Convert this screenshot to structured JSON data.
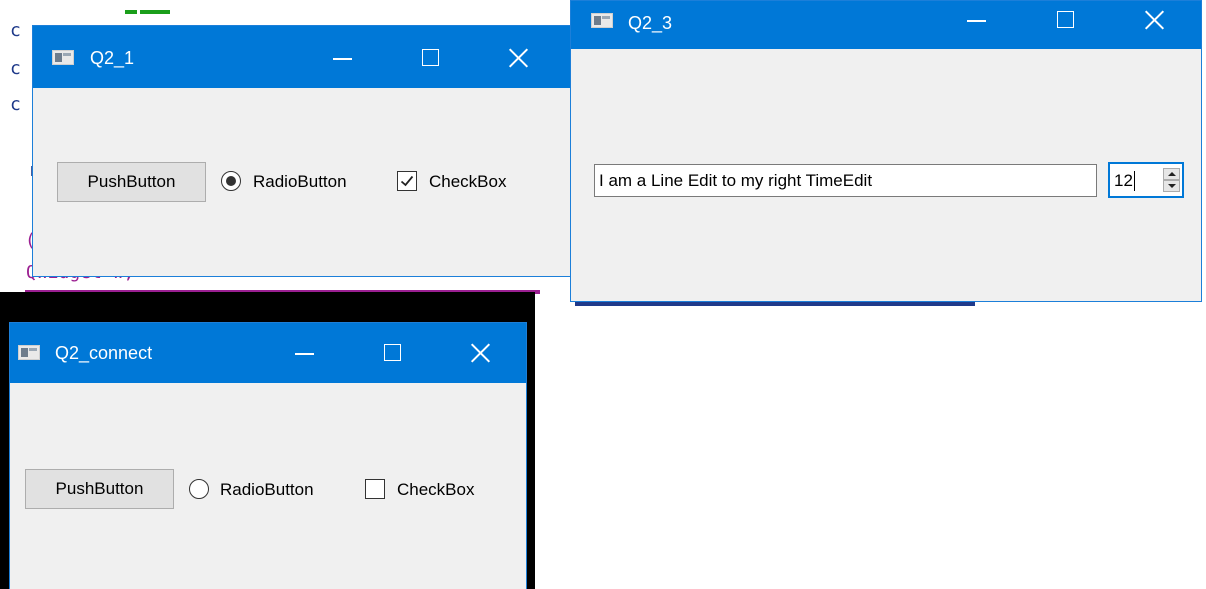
{
  "windows": {
    "q2_1": {
      "title": "Q2_1",
      "pushbutton_label": "PushButton",
      "radio_label": "RadioButton",
      "radio_checked": true,
      "checkbox_label": "CheckBox",
      "checkbox_checked": true
    },
    "q2_3": {
      "title": "Q2_3",
      "line_edit_value": "I am a Line Edit to my right TimeEdit",
      "time_edit_value": "12"
    },
    "q2_connect": {
      "title": "Q2_connect",
      "pushbutton_label": "PushButton",
      "radio_label": "RadioButton",
      "radio_checked": false,
      "checkbox_label": "CheckBox",
      "checkbox_checked": false
    }
  },
  "background_code": {
    "line1_char": "c",
    "line2_char": "c",
    "line3_char": "c",
    "line4_char": "r",
    "line5_char": "(",
    "line6_text": "QWidget w;"
  },
  "colors": {
    "titlebar": "#0078d7",
    "window_bg": "#f0f0f0",
    "code_keyword": "#1f3a8a",
    "code_type": "#9b1f91",
    "code_green": "#1a9e1a"
  },
  "icons": {
    "app": "qt-window-icon",
    "minimize": "minimize-icon",
    "maximize": "maximize-icon",
    "close": "close-icon",
    "check": "check-mark-icon"
  }
}
